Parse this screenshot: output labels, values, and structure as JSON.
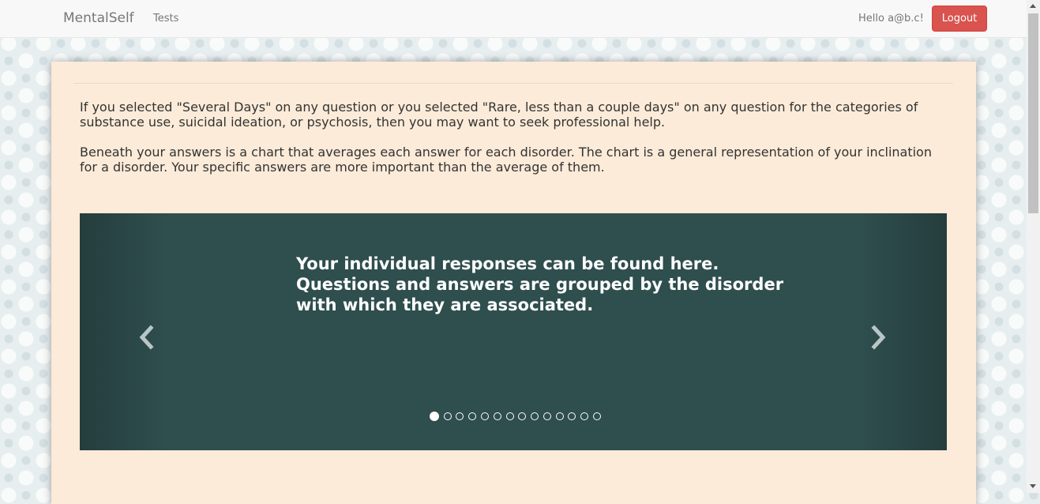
{
  "navbar": {
    "brand": "MentalSelf",
    "tests_link": "Tests",
    "greeting": "Hello a@b.c!",
    "logout_label": "Logout"
  },
  "intro": {
    "paragraph1": "If you selected \"Several Days\" on any question or you selected \"Rare, less than a couple days\" on any question for the categories of substance use, suicidal ideation, or psychosis, then you may want to seek professional help.",
    "paragraph2": "Beneath your answers is a chart that averages each answer for each disorder. The chart is a general representation of your inclination for a disorder. Your specific answers are more important than the average of them."
  },
  "carousel": {
    "caption": "Your individual responses can be found here. Questions and answers are grouped by the disorder with which they are associated.",
    "indicator_count": 14,
    "active_index": 0,
    "prev_icon": "chevron-left-icon",
    "next_icon": "chevron-right-icon"
  },
  "colors": {
    "logout": "#d9534f",
    "panel": "#fbebd8",
    "carousel": "#2f4e4e"
  }
}
